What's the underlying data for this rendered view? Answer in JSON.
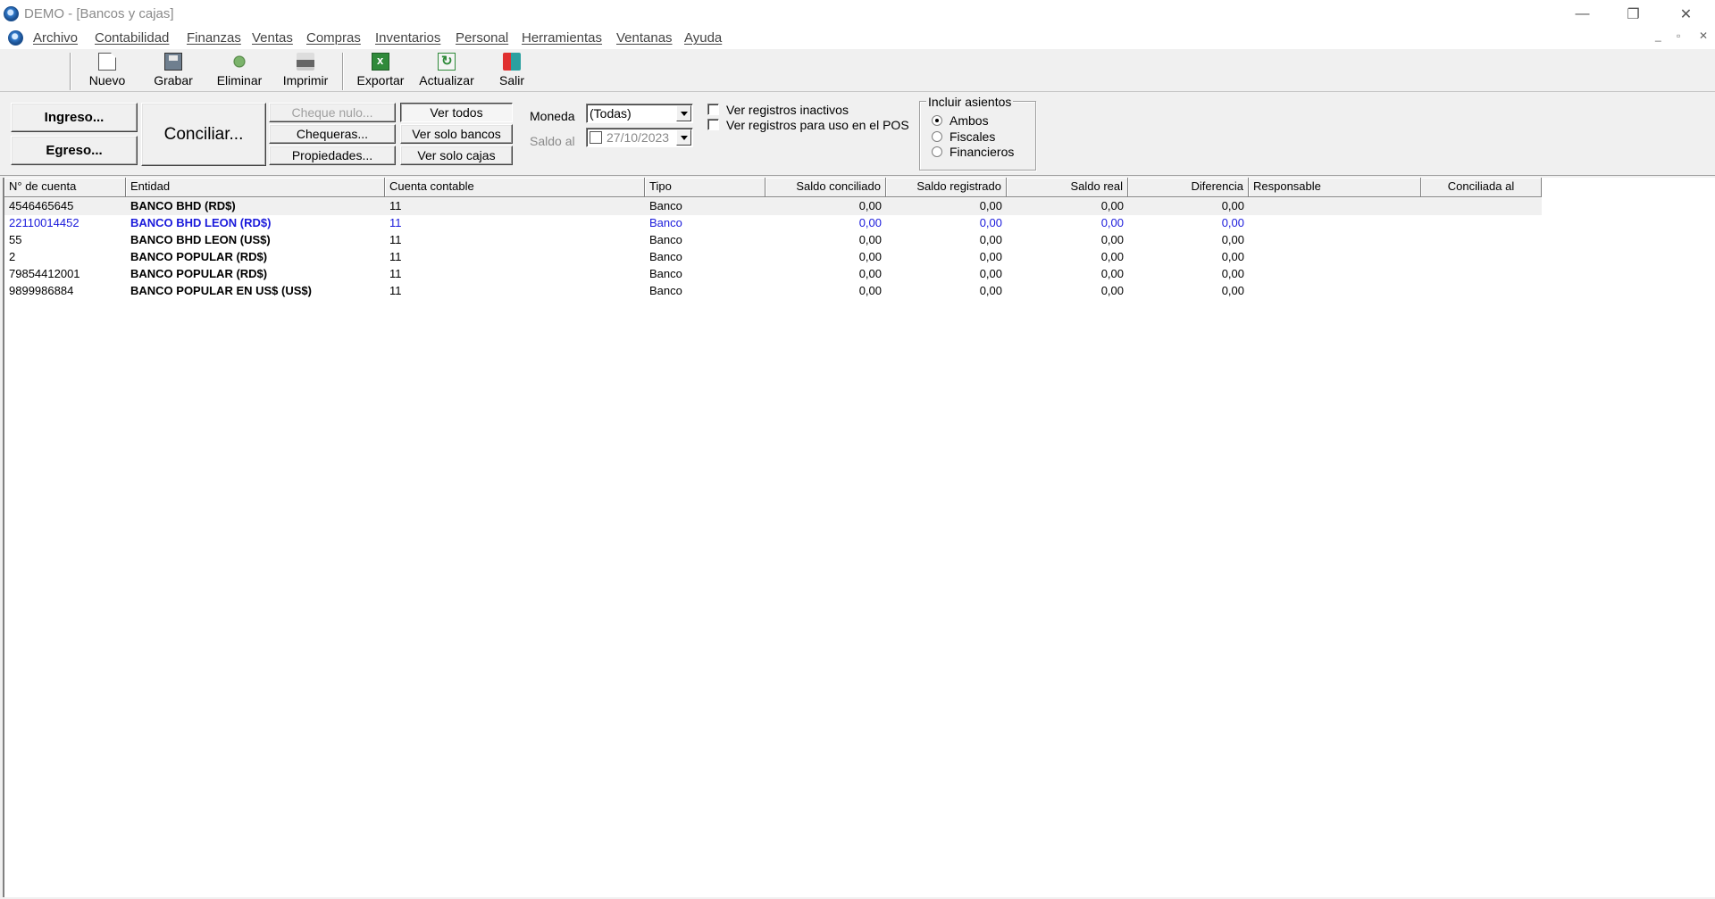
{
  "window": {
    "title": "DEMO - [Bancos y cajas]",
    "minimize": "—",
    "restore": "❐",
    "close": "✕"
  },
  "menu": {
    "items": [
      "Archivo",
      "Contabilidad",
      "Finanzas",
      "Ventas",
      "Compras",
      "Inventarios",
      "Personal",
      "Herramientas",
      "Ventanas",
      "Ayuda"
    ],
    "mdi_min": "_",
    "mdi_restore": "▫",
    "mdi_close": "✕"
  },
  "toolbar": {
    "nuevo": "Nuevo",
    "grabar": "Grabar",
    "eliminar": "Eliminar",
    "imprimir": "Imprimir",
    "exportar": "Exportar",
    "actualizar": "Actualizar",
    "salir": "Salir"
  },
  "panel": {
    "ingreso": "Ingreso...",
    "egreso": "Egreso...",
    "conciliar": "Conciliar...",
    "cheque_nulo": "Cheque nulo...",
    "chequeras": "Chequeras...",
    "propiedades": "Propiedades...",
    "ver_todos": "Ver todos",
    "ver_solo_bancos": "Ver solo bancos",
    "ver_solo_cajas": "Ver solo cajas",
    "moneda_label": "Moneda",
    "moneda_value": "(Todas)",
    "saldo_label": "Saldo al",
    "saldo_value": "27/10/2023",
    "ver_inactivos": "Ver registros inactivos",
    "ver_pos": "Ver registros para uso en el POS",
    "incluir_title": "Incluir asientos",
    "ambos": "Ambos",
    "fiscales": "Fiscales",
    "financieros": "Financieros"
  },
  "grid": {
    "headers": [
      "N° de cuenta",
      "Entidad",
      "Cuenta contable",
      "Tipo",
      "Saldo conciliado",
      "Saldo registrado",
      "Saldo real",
      "Diferencia",
      "Responsable",
      "Conciliada al"
    ],
    "rows": [
      {
        "cuenta": "4546465645",
        "entidad": "BANCO BHD (RD$)",
        "contable": "11",
        "tipo": "Banco",
        "conciliado": "0,00",
        "registrado": "0,00",
        "real": "0,00",
        "diferencia": "0,00"
      },
      {
        "cuenta": "22110014452",
        "entidad": "BANCO BHD LEON (RD$)",
        "contable": "11",
        "tipo": "Banco",
        "conciliado": "0,00",
        "registrado": "0,00",
        "real": "0,00",
        "diferencia": "0,00"
      },
      {
        "cuenta": "55",
        "entidad": "BANCO BHD LEON (US$)",
        "contable": "11",
        "tipo": "Banco",
        "conciliado": "0,00",
        "registrado": "0,00",
        "real": "0,00",
        "diferencia": "0,00"
      },
      {
        "cuenta": "2",
        "entidad": "BANCO POPULAR (RD$)",
        "contable": "11",
        "tipo": "Banco",
        "conciliado": "0,00",
        "registrado": "0,00",
        "real": "0,00",
        "diferencia": "0,00"
      },
      {
        "cuenta": "79854412001",
        "entidad": "BANCO POPULAR (RD$)",
        "contable": "11",
        "tipo": "Banco",
        "conciliado": "0,00",
        "registrado": "0,00",
        "real": "0,00",
        "diferencia": "0,00"
      },
      {
        "cuenta": "9899986884",
        "entidad": "BANCO POPULAR EN US$ (US$)",
        "contable": "11",
        "tipo": "Banco",
        "conciliado": "0,00",
        "registrado": "0,00",
        "real": "0,00",
        "diferencia": "0,00"
      }
    ]
  },
  "colors": {
    "selected_row_text": "#1a1adb",
    "window_bg": "#f0f0f0"
  }
}
